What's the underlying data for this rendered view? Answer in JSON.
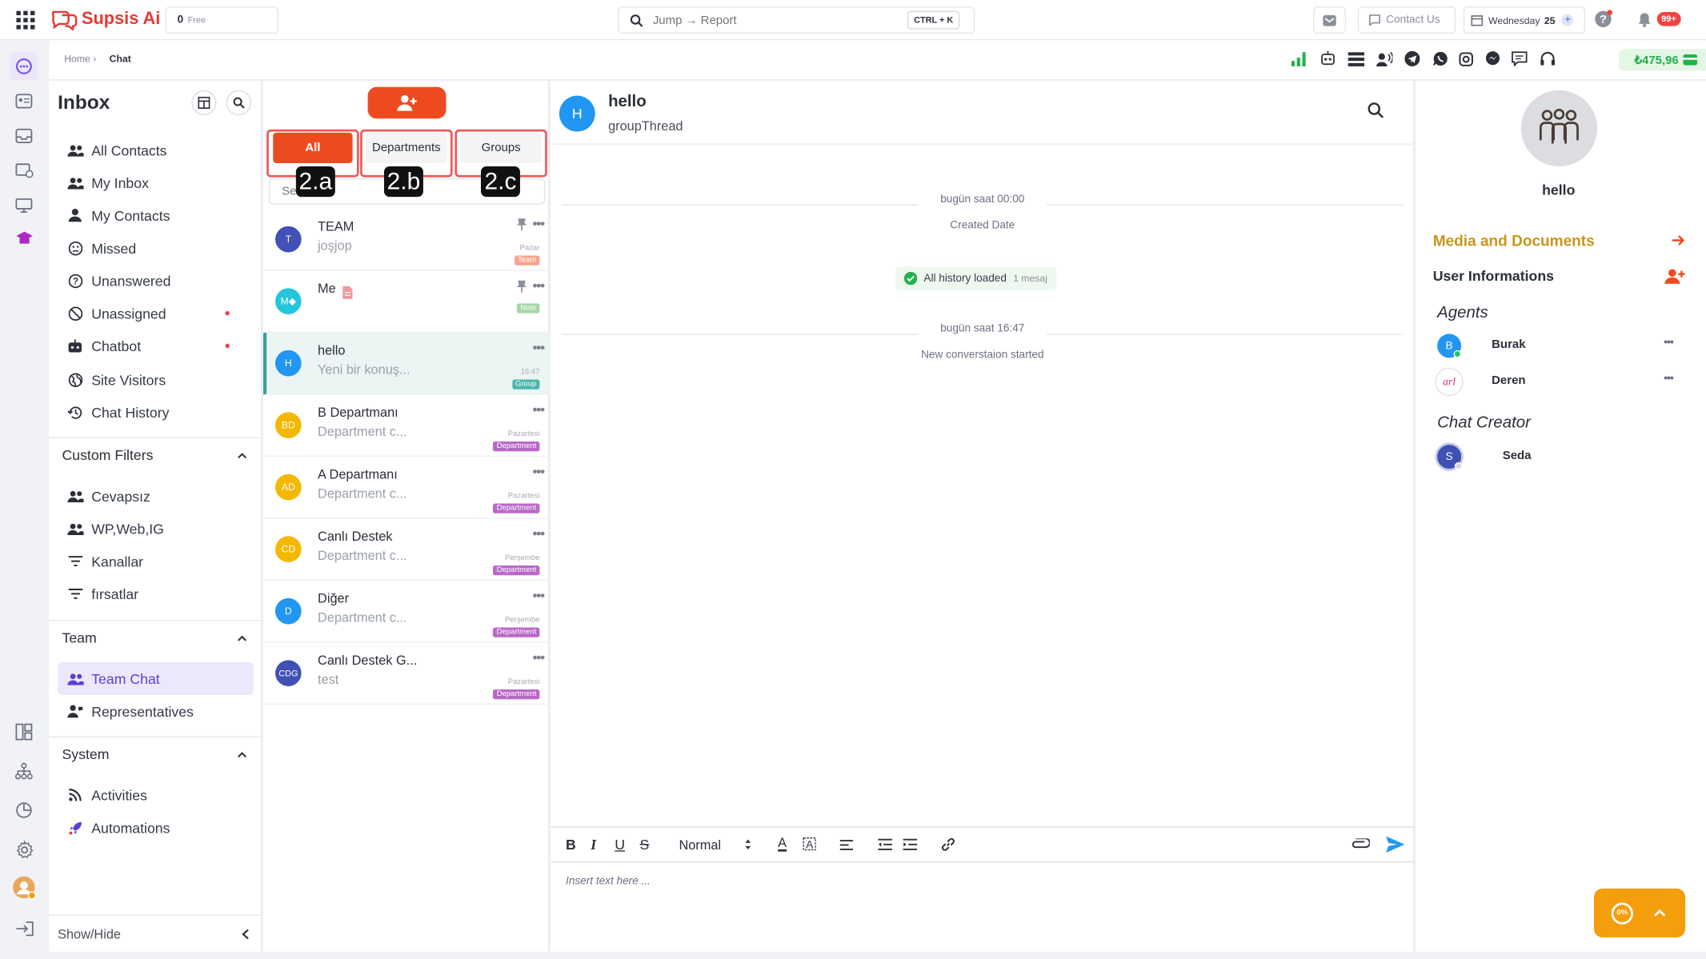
{
  "topbar": {
    "brand": "Supsis Ai",
    "plan_count": "0",
    "plan_label": "Free",
    "search_placeholder": "Jump → Report",
    "shortcut": "CTRL + K",
    "contact_us": "Contact Us",
    "date_label": "Wednesday",
    "date_day": "25",
    "notifications_badge": "99+"
  },
  "breadcrumb": {
    "home": "Home ›",
    "current": "Chat"
  },
  "toolbar": {
    "balance": "₺475,96"
  },
  "sidebar": {
    "title": "Inbox",
    "items": [
      {
        "label": "All Contacts"
      },
      {
        "label": "My Inbox"
      },
      {
        "label": "My Contacts"
      },
      {
        "label": "Missed"
      },
      {
        "label": "Unanswered"
      },
      {
        "label": "Unassigned"
      },
      {
        "label": "Chatbot"
      },
      {
        "label": "Site Visitors"
      },
      {
        "label": "Chat History"
      }
    ],
    "custom_filters": {
      "title": "Custom Filters",
      "items": [
        {
          "label": "Cevapsız"
        },
        {
          "label": "WP,Web,IG"
        },
        {
          "label": "Kanallar"
        },
        {
          "label": "fırsatlar"
        }
      ]
    },
    "team": {
      "title": "Team",
      "items": [
        {
          "label": "Team Chat"
        },
        {
          "label": "Representatives"
        }
      ]
    },
    "system": {
      "title": "System",
      "items": [
        {
          "label": "Activities"
        },
        {
          "label": "Automations"
        }
      ]
    },
    "show_hide": "Show/Hide"
  },
  "convlist": {
    "tabs": [
      {
        "label": "All"
      },
      {
        "label": "Departments"
      },
      {
        "label": "Groups"
      }
    ],
    "callouts": [
      "2.a",
      "2.b",
      "2.c"
    ],
    "search_placeholder": "Se",
    "items": [
      {
        "initials": "T",
        "name": "TEAM",
        "preview": "joşjop",
        "date": "Pazar",
        "tag": "Team"
      },
      {
        "initials": "M◆",
        "name": "Me",
        "preview": "",
        "date": "",
        "tag": "Note"
      },
      {
        "initials": "H",
        "name": "hello",
        "preview": "Yeni bir konuş...",
        "date": "16:47",
        "tag": "Group"
      },
      {
        "initials": "BD",
        "name": "B Departmanı",
        "preview": "Department c...",
        "date": "Pazartesi",
        "tag": "Department"
      },
      {
        "initials": "AD",
        "name": "A Departmanı",
        "preview": "Department c...",
        "date": "Pazartesi",
        "tag": "Department"
      },
      {
        "initials": "CD",
        "name": "Canlı Destek",
        "preview": "Department c...",
        "date": "Perşembe",
        "tag": "Department"
      },
      {
        "initials": "D",
        "name": "Diğer",
        "preview": "Department c...",
        "date": "Perşembe",
        "tag": "Department"
      },
      {
        "initials": "CDG",
        "name": "Canlı Destek G...",
        "preview": "test",
        "date": "Pazartesi",
        "tag": "Department"
      }
    ]
  },
  "chat": {
    "avatar": "H",
    "title": "hello",
    "subtitle": "groupThread",
    "sep1_time": "bugün saat 00:00",
    "sep1_label": "Created Date",
    "history_label": "All history loaded",
    "history_count": "1 mesaj",
    "sep2_time": "bugün saat 16:47",
    "sep2_label": "New converstaion started",
    "editor": {
      "format": "Normal",
      "placeholder": "Insert text here ..."
    }
  },
  "details": {
    "name": "hello",
    "media_label": "Media and Documents",
    "user_info_label": "User Informations",
    "agents_title": "Agents",
    "agents": [
      {
        "initial": "B",
        "name": "Burak"
      },
      {
        "initial": "arl",
        "name": "Deren"
      }
    ],
    "creator_title": "Chat Creator",
    "creator": {
      "initial": "S",
      "name": "Seda"
    }
  },
  "widget": {
    "progress": "0%"
  },
  "colors": {
    "accent": "#ee4a1f",
    "brand_red": "#e53935",
    "team_purple": "#5b3fd6",
    "gold": "#c8961c"
  }
}
